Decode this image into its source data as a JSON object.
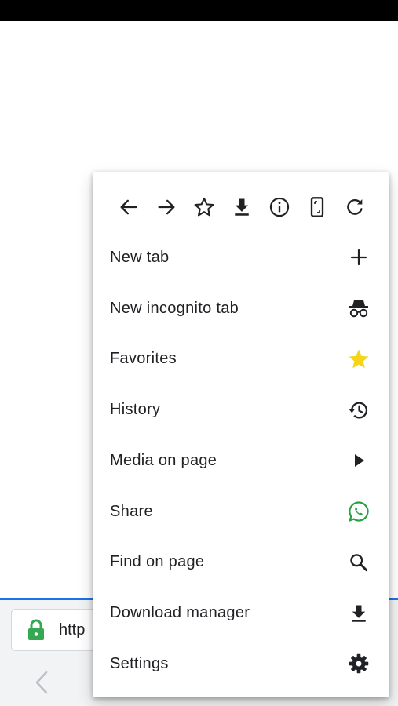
{
  "address_bar": {
    "url_text": "http"
  },
  "menu": {
    "top_icons": [
      {
        "icon": "arrow-left-icon"
      },
      {
        "icon": "arrow-right-icon"
      },
      {
        "icon": "star-outline-icon"
      },
      {
        "icon": "download-icon"
      },
      {
        "icon": "info-icon"
      },
      {
        "icon": "desktop-site-icon"
      },
      {
        "icon": "refresh-icon"
      }
    ],
    "items": [
      {
        "label": "New tab",
        "icon": "plus-icon"
      },
      {
        "label": "New incognito tab",
        "icon": "incognito-icon"
      },
      {
        "label": "Favorites",
        "icon": "star-filled-icon"
      },
      {
        "label": "History",
        "icon": "history-icon"
      },
      {
        "label": "Media on page",
        "icon": "play-icon"
      },
      {
        "label": "Share",
        "icon": "whatsapp-icon"
      },
      {
        "label": "Find on page",
        "icon": "search-icon"
      },
      {
        "label": "Download manager",
        "icon": "download-icon"
      },
      {
        "label": "Settings",
        "icon": "gear-icon"
      }
    ]
  },
  "colors": {
    "star_yellow": "#f5d518",
    "whatsapp_green": "#25a244",
    "lock_green": "#34a853",
    "progress_blue": "#1a73e8"
  }
}
